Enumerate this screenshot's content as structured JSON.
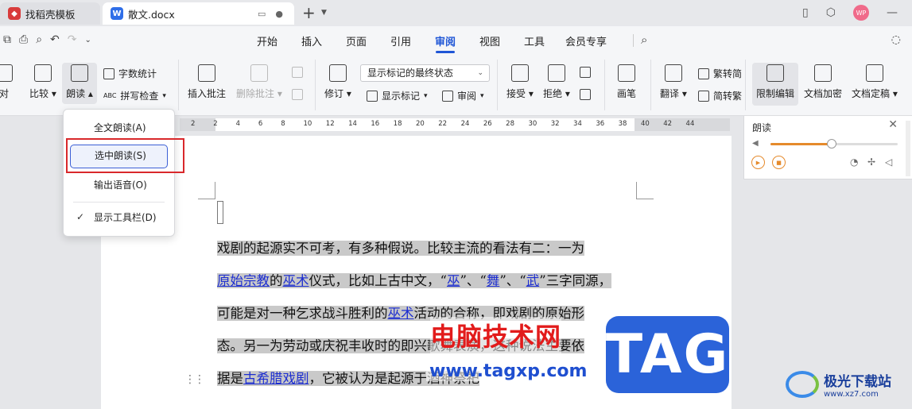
{
  "tabs": [
    {
      "label": "找稻壳模板"
    },
    {
      "label": "散文.docx"
    }
  ],
  "menu": [
    "开始",
    "插入",
    "页面",
    "引用",
    "审阅",
    "视图",
    "工具",
    "会员专享"
  ],
  "menu_active": "审阅",
  "ribbon": {
    "duijiao": "对",
    "bijiao": "比较",
    "langdu": "朗读",
    "zishu": "字数统计",
    "pinxie": "拼写检查",
    "abc": "ABC",
    "crtpizhu": "插入批注",
    "delpizhu": "删除批注",
    "xiuding": "修订",
    "mode_select": "显示标记的最终状态",
    "showmark": "显示标记",
    "shenyue": "审阅",
    "jieshou": "接受",
    "jujue": "拒绝",
    "huabi": "画笔",
    "fanyi": "翻译",
    "fanzhuanjian": "繁转简",
    "jianzhuanfan": "简转繁",
    "xianzhi": "限制编辑",
    "jiami": "文档加密",
    "dinggao": "文档定稿"
  },
  "ruler_numbers": [
    "2",
    "2",
    "4",
    "6",
    "8",
    "10",
    "12",
    "14",
    "16",
    "18",
    "20",
    "22",
    "24",
    "26",
    "28",
    "30",
    "32",
    "34",
    "36",
    "38",
    "40",
    "42",
    "44"
  ],
  "popup": {
    "items": [
      "全文朗读(A)",
      "选中朗读(S)",
      "输出语音(O)",
      "显示工具栏(D)"
    ],
    "check": "✓"
  },
  "read_panel": {
    "title": "朗读",
    "volume_level": 0.48
  },
  "document": {
    "line1": "戏剧的起源实不可考，有多种假说。比较主流的看法有二：一为",
    "line2_link1": "原始宗教",
    "line2_t1": "的",
    "line2_link2": "巫术",
    "line2_t2": "仪式，比如上古中文，“",
    "line2_link3": "巫",
    "line2_t3": "”、“",
    "line2_link4": "舞",
    "line2_t4": "”、“",
    "line2_link5": "武",
    "line2_t5": "”三字同源，",
    "line3_t1": "可能是对一种乞求战斗胜利的",
    "line3_link": "巫术",
    "line3_t2": "活动的合称，即戏剧的原始形",
    "line4": "态。另一为劳动或庆祝丰收时的即兴歌舞表演，这种说法主要依",
    "line5_t1": "据是",
    "line5_link": "古希腊戏剧",
    "line5_t2": "，它被认为是起源于酒神祭祀"
  },
  "watermark": {
    "cn": "电脑技术网",
    "url": "www.tagxp.com",
    "tag": "TAG",
    "logo_cn": "极光下载站",
    "logo_url": "www.xz7.com"
  }
}
